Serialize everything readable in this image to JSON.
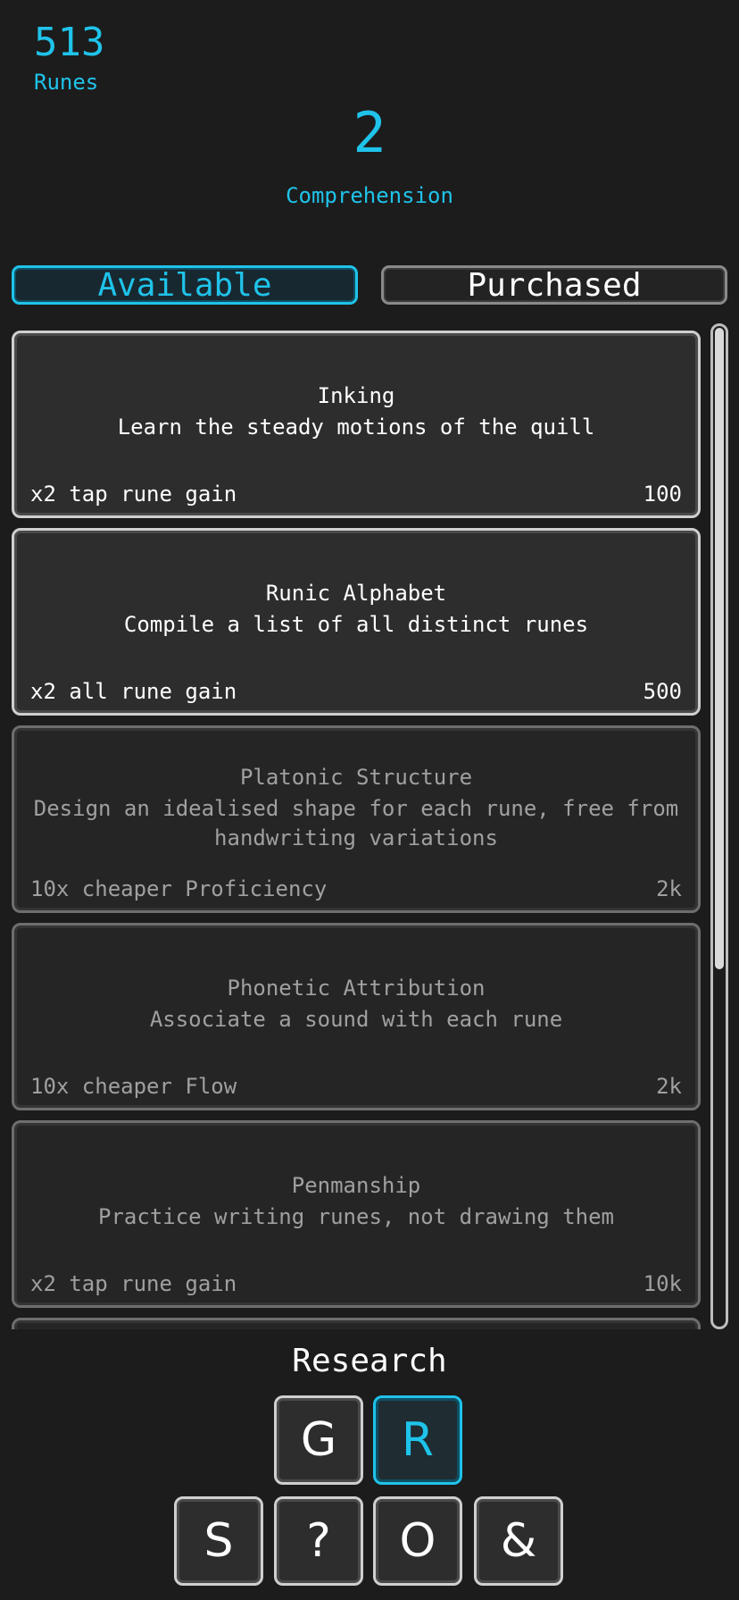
{
  "header": {
    "runes_value": "513",
    "runes_label": "Runes",
    "comprehension_value": "2",
    "comprehension_label": "Comprehension"
  },
  "tabs": {
    "available": "Available",
    "purchased": "Purchased",
    "selected": "available"
  },
  "upgrades": [
    {
      "title": "Inking",
      "description": "Learn the steady motions of the quill",
      "effect": "x2 tap rune gain",
      "cost": "100",
      "affordable": true
    },
    {
      "title": "Runic Alphabet",
      "description": "Compile a list of all distinct runes",
      "effect": "x2 all rune gain",
      "cost": "500",
      "affordable": true
    },
    {
      "title": "Platonic Structure",
      "description": "Design an idealised shape for each rune, free from handwriting variations",
      "effect": "10x cheaper Proficiency",
      "cost": "2k",
      "affordable": false
    },
    {
      "title": "Phonetic Attribution",
      "description": "Associate a sound with each rune",
      "effect": "10x cheaper Flow",
      "cost": "2k",
      "affordable": false
    },
    {
      "title": "Penmanship",
      "description": "Practice writing runes, not drawing them",
      "effect": "x2 tap rune gain",
      "cost": "10k",
      "affordable": false
    }
  ],
  "section_label": "Research",
  "nav": {
    "g": "G",
    "r": "R",
    "s": "S",
    "help": "?",
    "o": "O",
    "amp": "&",
    "active": "R"
  },
  "colors": {
    "accent": "#1fc3ea",
    "background": "#1c1c1c",
    "card": "#2d2d2d"
  }
}
